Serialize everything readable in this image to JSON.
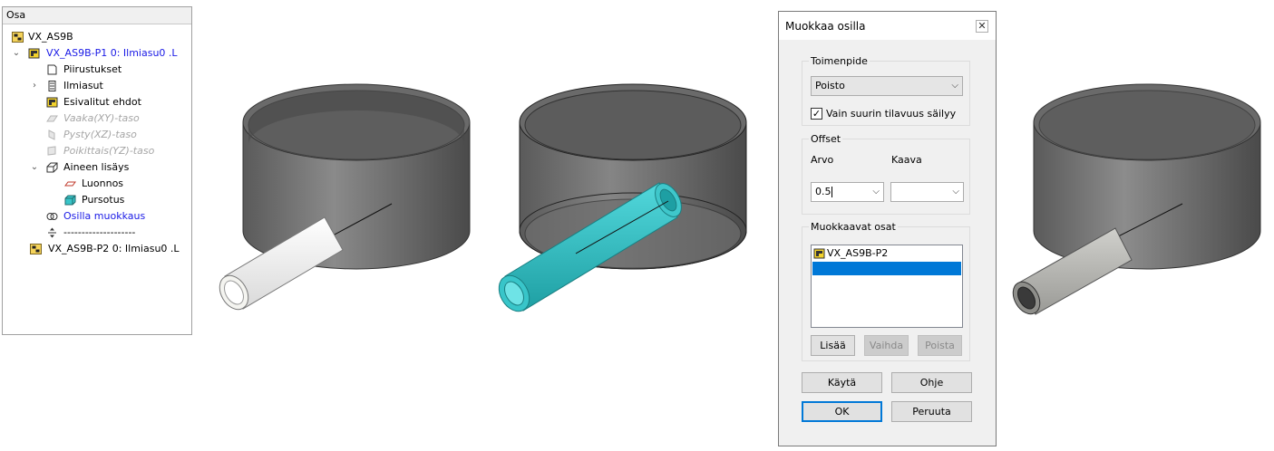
{
  "tree": {
    "title": "Osa",
    "items": [
      {
        "label": "VX_AS9B",
        "icon": "assembly-icon",
        "expander": ""
      },
      {
        "label": "VX_AS9B-P1 0: Ilmiasu0 .L",
        "icon": "part-icon",
        "expander": "⌄"
      },
      {
        "label": "Piirustukset",
        "icon": "drawings-icon",
        "expander": ""
      },
      {
        "label": "Ilmiasut",
        "icon": "configurations-icon",
        "expander": "›"
      },
      {
        "label": "Esivalitut ehdot",
        "icon": "conditions-icon",
        "expander": ""
      },
      {
        "label": "Vaaka(XY)-taso",
        "icon": "plane-icon",
        "expander": ""
      },
      {
        "label": "Pysty(XZ)-taso",
        "icon": "plane-icon",
        "expander": ""
      },
      {
        "label": "Poikittais(YZ)-taso",
        "icon": "plane-icon",
        "expander": ""
      },
      {
        "label": "Aineen lisäys",
        "icon": "add-material-icon",
        "expander": "⌄"
      },
      {
        "label": "Luonnos",
        "icon": "sketch-icon",
        "expander": ""
      },
      {
        "label": "Pursotus",
        "icon": "extrude-icon",
        "expander": ""
      },
      {
        "label": "Osilla muokkaus",
        "icon": "modify-by-parts-icon",
        "expander": ""
      },
      {
        "label": "--------------------",
        "icon": "end-marker-icon",
        "expander": ""
      },
      {
        "label": "VX_AS9B-P2 0: Ilmiasu0 .L",
        "icon": "assembly-icon",
        "expander": ""
      }
    ]
  },
  "dialog": {
    "title": "Muokkaa osilla",
    "close": "✕",
    "toimenpide": {
      "group_label": "Toimenpide",
      "selected": "Poisto",
      "checkbox_label": "Vain suurin tilavuus säilyy",
      "checkbox_checked": true
    },
    "offset": {
      "group_label": "Offset",
      "arvo_label": "Arvo",
      "kaava_label": "Kaava",
      "arvo_value": "0.5",
      "kaava_value": ""
    },
    "parts": {
      "group_label": "Muokkaavat osat",
      "items": [
        "VX_AS9B-P2"
      ],
      "add_label": "Lisää",
      "replace_label": "Vaihda",
      "remove_label": "Poista"
    },
    "buttons": {
      "apply": "Käytä",
      "help": "Ohje",
      "ok": "OK",
      "cancel": "Peruuta"
    }
  },
  "colors": {
    "accent": "#0078d7",
    "tree_link": "#1a1ae6",
    "tool_part": "#38c5c9",
    "cylinder": "#8c8c8c"
  }
}
